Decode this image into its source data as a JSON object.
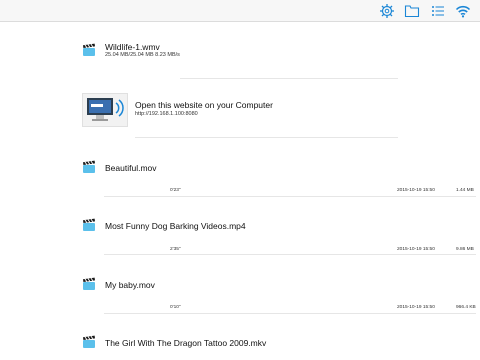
{
  "toolbar": {
    "icons": [
      "gear-icon",
      "folder-icon",
      "list-icon",
      "wifi-icon"
    ],
    "accent": "#1a86d6"
  },
  "current_download": {
    "name": "Wildlife-1.wmv",
    "progress_text": "25.04 MB/25.04 MB  8.23 MB/s",
    "progress": 1.0
  },
  "website_banner": {
    "title": "Open this website on your Computer",
    "url": "http://192.168.1.100:8080"
  },
  "files": [
    {
      "name": "Beautiful.mov",
      "duration": "0'23\"",
      "date": "2015-10-19 15:50",
      "size": "1.44 MB"
    },
    {
      "name": "Most Funny Dog Barking Videos.mp4",
      "duration": "2'35\"",
      "date": "2015-10-19 15:50",
      "size": "9.86 MB"
    },
    {
      "name": "My baby.mov",
      "duration": "0'10\"",
      "date": "2015-10-19 15:50",
      "size": "966.4 KB"
    },
    {
      "name": "The Girl With The Dragon Tattoo 2009.mkv",
      "duration": "",
      "date": "",
      "size": ""
    }
  ]
}
